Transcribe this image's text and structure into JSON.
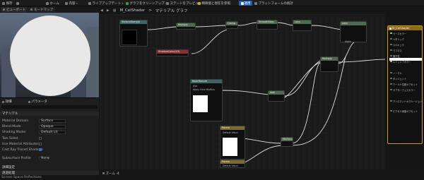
{
  "toolbar": {
    "items": [
      "保存",
      "",
      "ホーム",
      "内容",
      "ライブアップデート",
      "グラフをクリーンアップ",
      "ステートをプレビュー",
      "特徴値と現在を参照",
      "適用",
      "プラットフォームの統計"
    ],
    "apply_label": "適用",
    "platform_label": "プラットフォームの統計"
  },
  "tabs": {
    "viewport": "ビューポート",
    "preview": "モードマップ"
  },
  "breadcrumb": {
    "asset": "M_CelShader",
    "separator": ">",
    "graph": "マテリアル グラフ"
  },
  "details": {
    "tab_details": "詳細",
    "tab_params": "パラメータ",
    "section_material": "マテリアル",
    "props": [
      {
        "label": "Material Domain",
        "value": "Surface"
      },
      {
        "label": "Blend Mode",
        "value": "Opaque"
      },
      {
        "label": "Shading Model",
        "value": "Default Lit"
      },
      {
        "label": "Two Sided",
        "value": ""
      },
      {
        "label": "Use Material Attributes",
        "value": ""
      },
      {
        "label": "Cast Ray Traced Shadows",
        "value": ""
      },
      {
        "label": "Subsurface Profile",
        "value": "None"
      }
    ],
    "section_advanced": "詳細設定",
    "section_lighting": "透過処理",
    "status": "Screen Space Reflections"
  },
  "graph_nodes": [
    {
      "id": "tex-sample",
      "title": "TextureSample",
      "hdr": "teal"
    },
    {
      "id": "mul1",
      "title": "Multiply",
      "hdr": "green"
    },
    {
      "id": "clamp",
      "title": "Clamp",
      "hdr": "green"
    },
    {
      "id": "smooth",
      "title": "SmoothStep",
      "hdr": "green"
    },
    {
      "id": "lerp1",
      "title": "Lerp",
      "hdr": "green"
    },
    {
      "id": "lerp2",
      "title": "Lerp",
      "hdr": "green"
    },
    {
      "id": "shadow-color",
      "title": "ShadowColor(V3)",
      "hdr": "red"
    },
    {
      "id": "base-tex",
      "title": "BaseTexture",
      "hdr": "teal"
    },
    {
      "id": "add1",
      "title": "Add",
      "hdr": "green"
    },
    {
      "id": "mul2",
      "title": "Multiply",
      "hdr": "green"
    },
    {
      "id": "param-a",
      "title": "Param",
      "hdr": "olive"
    },
    {
      "id": "param-b",
      "title": "Param",
      "hdr": "olive"
    },
    {
      "id": "mul3",
      "title": "Multiply",
      "hdr": "green"
    }
  ],
  "graph_labels": {
    "alpha": "Alpha",
    "uv": "UVs",
    "apply_view_mip": "Apply View MipBias",
    "value": "Default Value"
  },
  "result_node": {
    "title": "M_CelShader",
    "pins": [
      {
        "label": "ベースカラー",
        "on": true
      },
      {
        "label": "メタリック",
        "on": false
      },
      {
        "label": "スペキュラ",
        "on": false
      },
      {
        "label": "ラフネス",
        "on": false
      },
      {
        "label": "異方性",
        "on": false
      },
      {
        "label": "エミッシブカラー",
        "on": true
      },
      {
        "label": "ノーマル",
        "on": false
      },
      {
        "label": "タンジェント",
        "on": false
      },
      {
        "label": "ワールド位置オフセット",
        "on": false
      },
      {
        "label": "サブサーフェスカラー",
        "on": false
      },
      {
        "label": "アンビエントオクルージョン",
        "on": false
      },
      {
        "label": "ピクセル深度オフセット",
        "on": false
      }
    ]
  },
  "graphbar": {
    "zoom_label": "ズーム -4"
  },
  "colors": {
    "accent": "#1f5fbf",
    "result_border": "#c99a1e",
    "active_pin": "#b5dd5a"
  }
}
